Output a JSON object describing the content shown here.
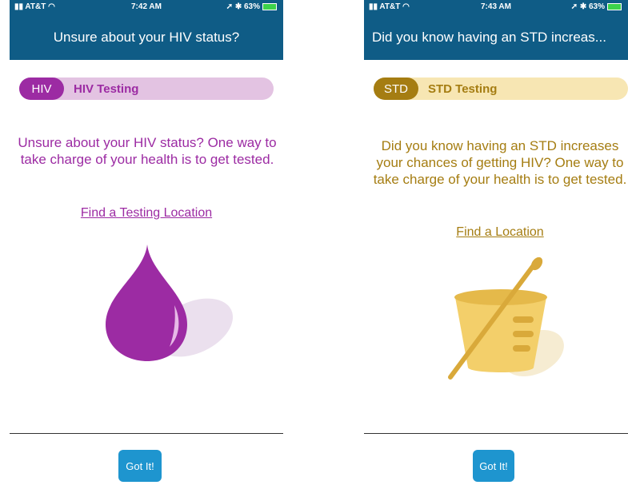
{
  "left": {
    "status": {
      "carrier": "AT&T",
      "time": "7:42 AM",
      "battery": "63%"
    },
    "title": "Unsure about your HIV status?",
    "badge": "HIV",
    "pill_label": "HIV Testing",
    "message": "Unsure about your HIV status? One way to take charge of your health is to get tested.",
    "link": "Find a Testing Location",
    "button": "Got It!",
    "colors": {
      "accent": "#9c2ba3",
      "pill_bg": "#e3c3e2"
    }
  },
  "right": {
    "status": {
      "carrier": "AT&T",
      "time": "7:43 AM",
      "battery": "63%"
    },
    "title": "Did you know having an STD increas...",
    "badge": "STD",
    "pill_label": "STD Testing",
    "message": "Did you know having an STD increases your chances of getting HIV? One way to take charge of your health is to get tested.",
    "link": "Find a Location",
    "button": "Got It!",
    "colors": {
      "accent": "#a57d12",
      "pill_bg": "#f7e6b3"
    }
  },
  "colors": {
    "header": "#0f5c86",
    "button": "#1e95cf"
  },
  "icons": {
    "left_illustration": "blood-drop-icon",
    "right_illustration": "specimen-cup-swab-icon"
  }
}
